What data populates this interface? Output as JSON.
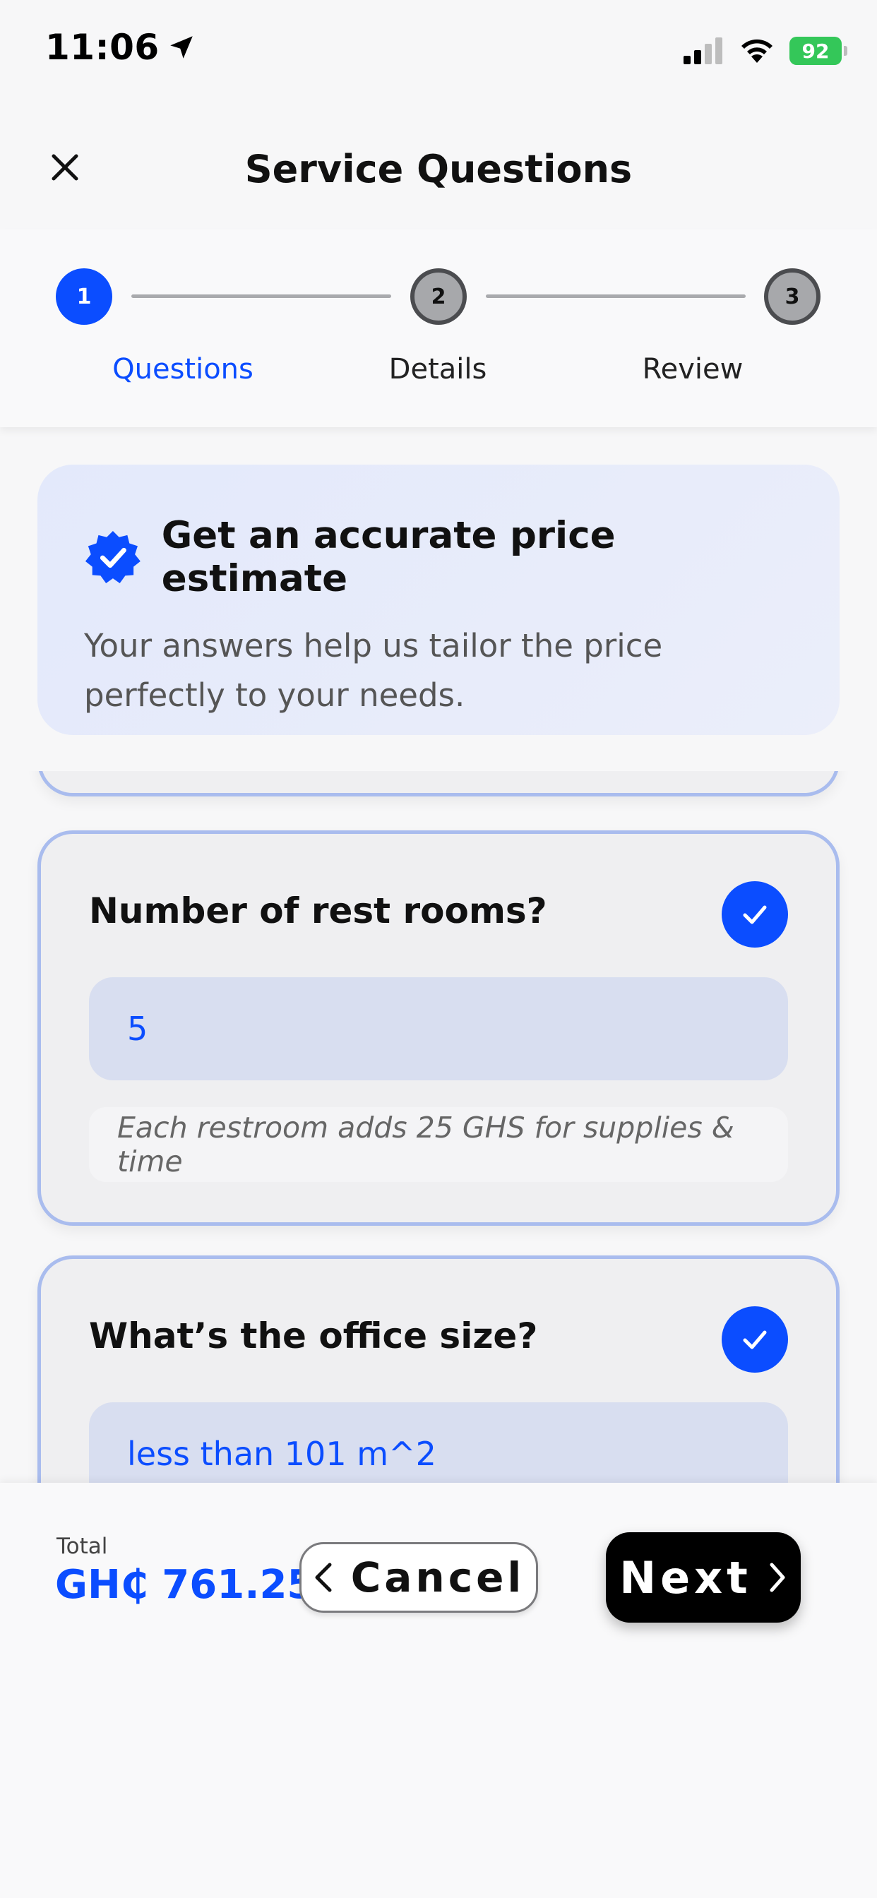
{
  "status_bar": {
    "time": "11:06",
    "battery": "92"
  },
  "header": {
    "title": "Service Questions"
  },
  "stepper": {
    "steps": [
      {
        "number": "1",
        "label": "Questions",
        "state": "active"
      },
      {
        "number": "2",
        "label": "Details",
        "state": "inactive"
      },
      {
        "number": "3",
        "label": "Review",
        "state": "inactive"
      }
    ]
  },
  "info": {
    "title": "Get an accurate price estimate",
    "text": "Your answers help us tailor the price perfectly to your needs."
  },
  "questions": [
    {
      "title": "Number of rest rooms?",
      "answer": "5",
      "hint": "Each restroom adds 25 GHS for supplies & time",
      "answered": true
    },
    {
      "title": "What’s the office size?",
      "answer": "less than 101 m^2",
      "answered": true
    }
  ],
  "footer": {
    "total_label": "Total",
    "total_value": "GH₵ 761.25",
    "cancel_label": "Cancel",
    "next_label": "Next"
  },
  "colors": {
    "accent": "#0b4dff",
    "card_border": "#a9bcee",
    "answer_bg": "#d8def0",
    "battery": "#34c759"
  }
}
